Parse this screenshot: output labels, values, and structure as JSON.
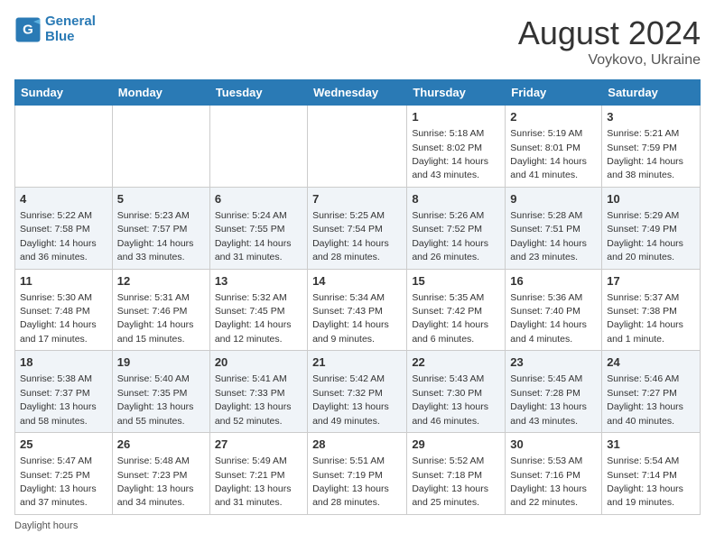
{
  "header": {
    "logo_line1": "General",
    "logo_line2": "Blue",
    "main_title": "August 2024",
    "subtitle": "Voykovo, Ukraine"
  },
  "days_of_week": [
    "Sunday",
    "Monday",
    "Tuesday",
    "Wednesday",
    "Thursday",
    "Friday",
    "Saturday"
  ],
  "weeks": [
    [
      {
        "day": "",
        "info": ""
      },
      {
        "day": "",
        "info": ""
      },
      {
        "day": "",
        "info": ""
      },
      {
        "day": "",
        "info": ""
      },
      {
        "day": "1",
        "info": "Sunrise: 5:18 AM\nSunset: 8:02 PM\nDaylight: 14 hours and 43 minutes."
      },
      {
        "day": "2",
        "info": "Sunrise: 5:19 AM\nSunset: 8:01 PM\nDaylight: 14 hours and 41 minutes."
      },
      {
        "day": "3",
        "info": "Sunrise: 5:21 AM\nSunset: 7:59 PM\nDaylight: 14 hours and 38 minutes."
      }
    ],
    [
      {
        "day": "4",
        "info": "Sunrise: 5:22 AM\nSunset: 7:58 PM\nDaylight: 14 hours and 36 minutes."
      },
      {
        "day": "5",
        "info": "Sunrise: 5:23 AM\nSunset: 7:57 PM\nDaylight: 14 hours and 33 minutes."
      },
      {
        "day": "6",
        "info": "Sunrise: 5:24 AM\nSunset: 7:55 PM\nDaylight: 14 hours and 31 minutes."
      },
      {
        "day": "7",
        "info": "Sunrise: 5:25 AM\nSunset: 7:54 PM\nDaylight: 14 hours and 28 minutes."
      },
      {
        "day": "8",
        "info": "Sunrise: 5:26 AM\nSunset: 7:52 PM\nDaylight: 14 hours and 26 minutes."
      },
      {
        "day": "9",
        "info": "Sunrise: 5:28 AM\nSunset: 7:51 PM\nDaylight: 14 hours and 23 minutes."
      },
      {
        "day": "10",
        "info": "Sunrise: 5:29 AM\nSunset: 7:49 PM\nDaylight: 14 hours and 20 minutes."
      }
    ],
    [
      {
        "day": "11",
        "info": "Sunrise: 5:30 AM\nSunset: 7:48 PM\nDaylight: 14 hours and 17 minutes."
      },
      {
        "day": "12",
        "info": "Sunrise: 5:31 AM\nSunset: 7:46 PM\nDaylight: 14 hours and 15 minutes."
      },
      {
        "day": "13",
        "info": "Sunrise: 5:32 AM\nSunset: 7:45 PM\nDaylight: 14 hours and 12 minutes."
      },
      {
        "day": "14",
        "info": "Sunrise: 5:34 AM\nSunset: 7:43 PM\nDaylight: 14 hours and 9 minutes."
      },
      {
        "day": "15",
        "info": "Sunrise: 5:35 AM\nSunset: 7:42 PM\nDaylight: 14 hours and 6 minutes."
      },
      {
        "day": "16",
        "info": "Sunrise: 5:36 AM\nSunset: 7:40 PM\nDaylight: 14 hours and 4 minutes."
      },
      {
        "day": "17",
        "info": "Sunrise: 5:37 AM\nSunset: 7:38 PM\nDaylight: 14 hours and 1 minute."
      }
    ],
    [
      {
        "day": "18",
        "info": "Sunrise: 5:38 AM\nSunset: 7:37 PM\nDaylight: 13 hours and 58 minutes."
      },
      {
        "day": "19",
        "info": "Sunrise: 5:40 AM\nSunset: 7:35 PM\nDaylight: 13 hours and 55 minutes."
      },
      {
        "day": "20",
        "info": "Sunrise: 5:41 AM\nSunset: 7:33 PM\nDaylight: 13 hours and 52 minutes."
      },
      {
        "day": "21",
        "info": "Sunrise: 5:42 AM\nSunset: 7:32 PM\nDaylight: 13 hours and 49 minutes."
      },
      {
        "day": "22",
        "info": "Sunrise: 5:43 AM\nSunset: 7:30 PM\nDaylight: 13 hours and 46 minutes."
      },
      {
        "day": "23",
        "info": "Sunrise: 5:45 AM\nSunset: 7:28 PM\nDaylight: 13 hours and 43 minutes."
      },
      {
        "day": "24",
        "info": "Sunrise: 5:46 AM\nSunset: 7:27 PM\nDaylight: 13 hours and 40 minutes."
      }
    ],
    [
      {
        "day": "25",
        "info": "Sunrise: 5:47 AM\nSunset: 7:25 PM\nDaylight: 13 hours and 37 minutes."
      },
      {
        "day": "26",
        "info": "Sunrise: 5:48 AM\nSunset: 7:23 PM\nDaylight: 13 hours and 34 minutes."
      },
      {
        "day": "27",
        "info": "Sunrise: 5:49 AM\nSunset: 7:21 PM\nDaylight: 13 hours and 31 minutes."
      },
      {
        "day": "28",
        "info": "Sunrise: 5:51 AM\nSunset: 7:19 PM\nDaylight: 13 hours and 28 minutes."
      },
      {
        "day": "29",
        "info": "Sunrise: 5:52 AM\nSunset: 7:18 PM\nDaylight: 13 hours and 25 minutes."
      },
      {
        "day": "30",
        "info": "Sunrise: 5:53 AM\nSunset: 7:16 PM\nDaylight: 13 hours and 22 minutes."
      },
      {
        "day": "31",
        "info": "Sunrise: 5:54 AM\nSunset: 7:14 PM\nDaylight: 13 hours and 19 minutes."
      }
    ]
  ],
  "footer": {
    "note": "Daylight hours"
  }
}
